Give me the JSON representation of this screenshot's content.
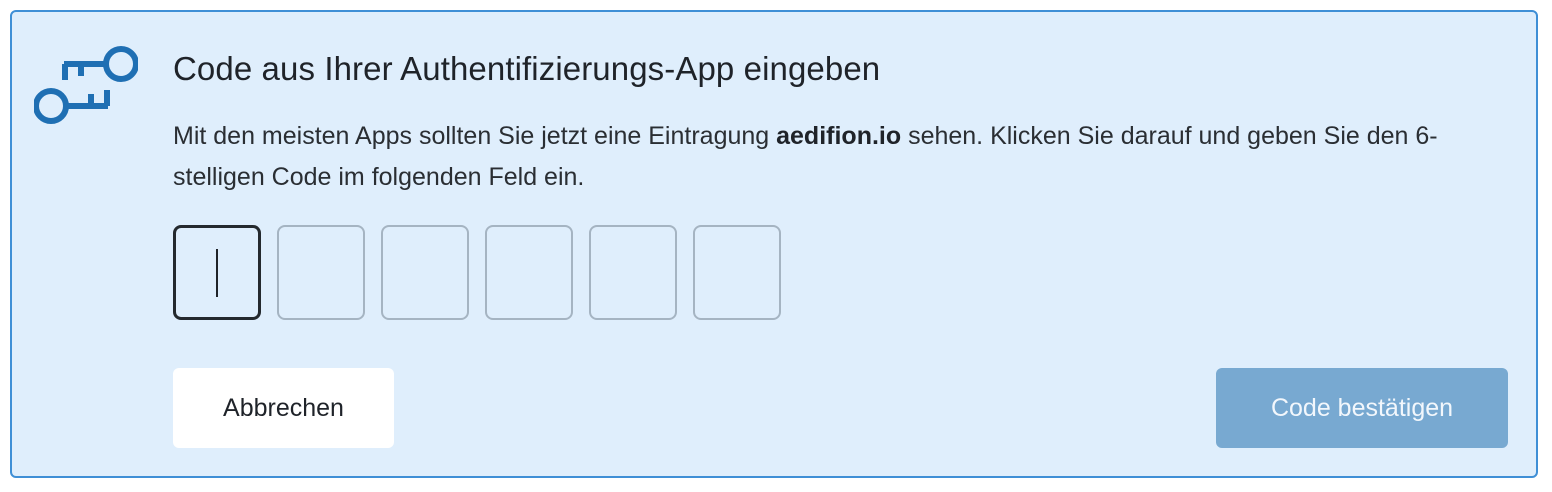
{
  "dialog": {
    "title": "Code aus Ihrer Authentifizierungs-App eingeben",
    "description_before": "Mit den meisten Apps sollten Sie jetzt eine Eintragung ",
    "description_bold": "aedifion.io",
    "description_after": " sehen. Klicken Sie darauf und geben Sie den 6-stelligen Code im folgenden Feld ein.",
    "icon": "key-icon",
    "code_digits": [
      "",
      "",
      "",
      "",
      "",
      ""
    ],
    "cancel_label": "Abbrechen",
    "confirm_label": "Code bestätigen"
  },
  "colors": {
    "panel_background": "#dfeefc",
    "panel_border": "#3f8fd6",
    "icon": "#1f6fb3",
    "confirm_button": "#78a9d1",
    "cancel_button": "#ffffff"
  }
}
